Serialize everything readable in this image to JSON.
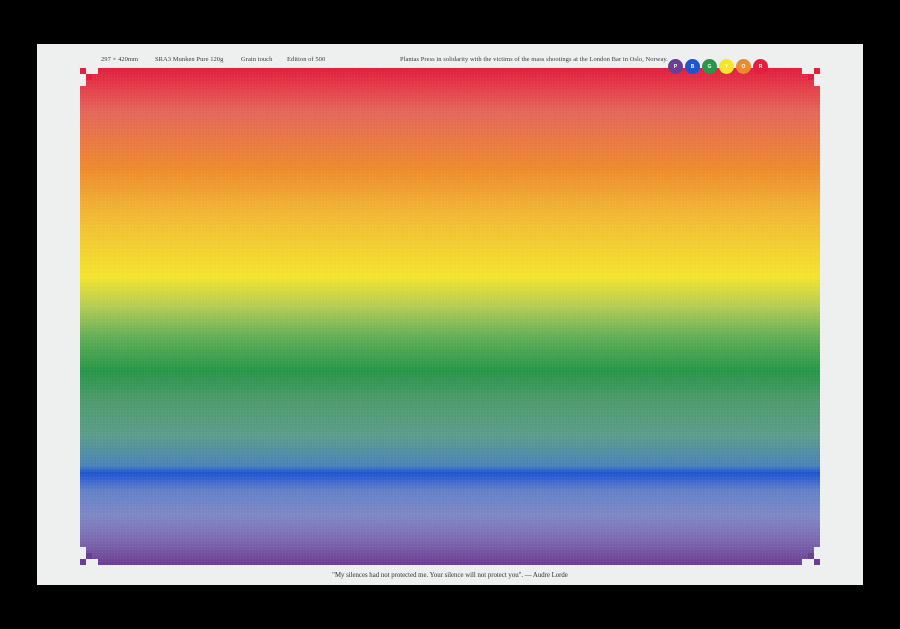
{
  "poster": {
    "size": "297 × 420mm",
    "paper": "SRA3 Munken Pure 120g",
    "grain": "Grain touch",
    "edition": "Edition of 500",
    "statement": "Plantas Press in solidarity with the victims of the mass shootings at the London Bar in Oslo, Norway.",
    "quote": "\"My silences had not protected me. Your silence will not protect you\". — Audre Lorde"
  },
  "color_dots": [
    {
      "letter": "P",
      "color": "#6a3f93"
    },
    {
      "letter": "B",
      "color": "#1f54d1"
    },
    {
      "letter": "G",
      "color": "#27974a"
    },
    {
      "letter": "Y",
      "color": "#f4e52e"
    },
    {
      "letter": "O",
      "color": "#ee8a2e"
    },
    {
      "letter": "R",
      "color": "#e21f3e"
    }
  ],
  "colors": {
    "background": "#000000",
    "paper": "#eef0f0",
    "red": "#e21f3e",
    "orange": "#ee8a2e",
    "yellow": "#f4e52e",
    "green": "#27974a",
    "blue": "#1f54d1",
    "purple": "#6a3f93"
  }
}
